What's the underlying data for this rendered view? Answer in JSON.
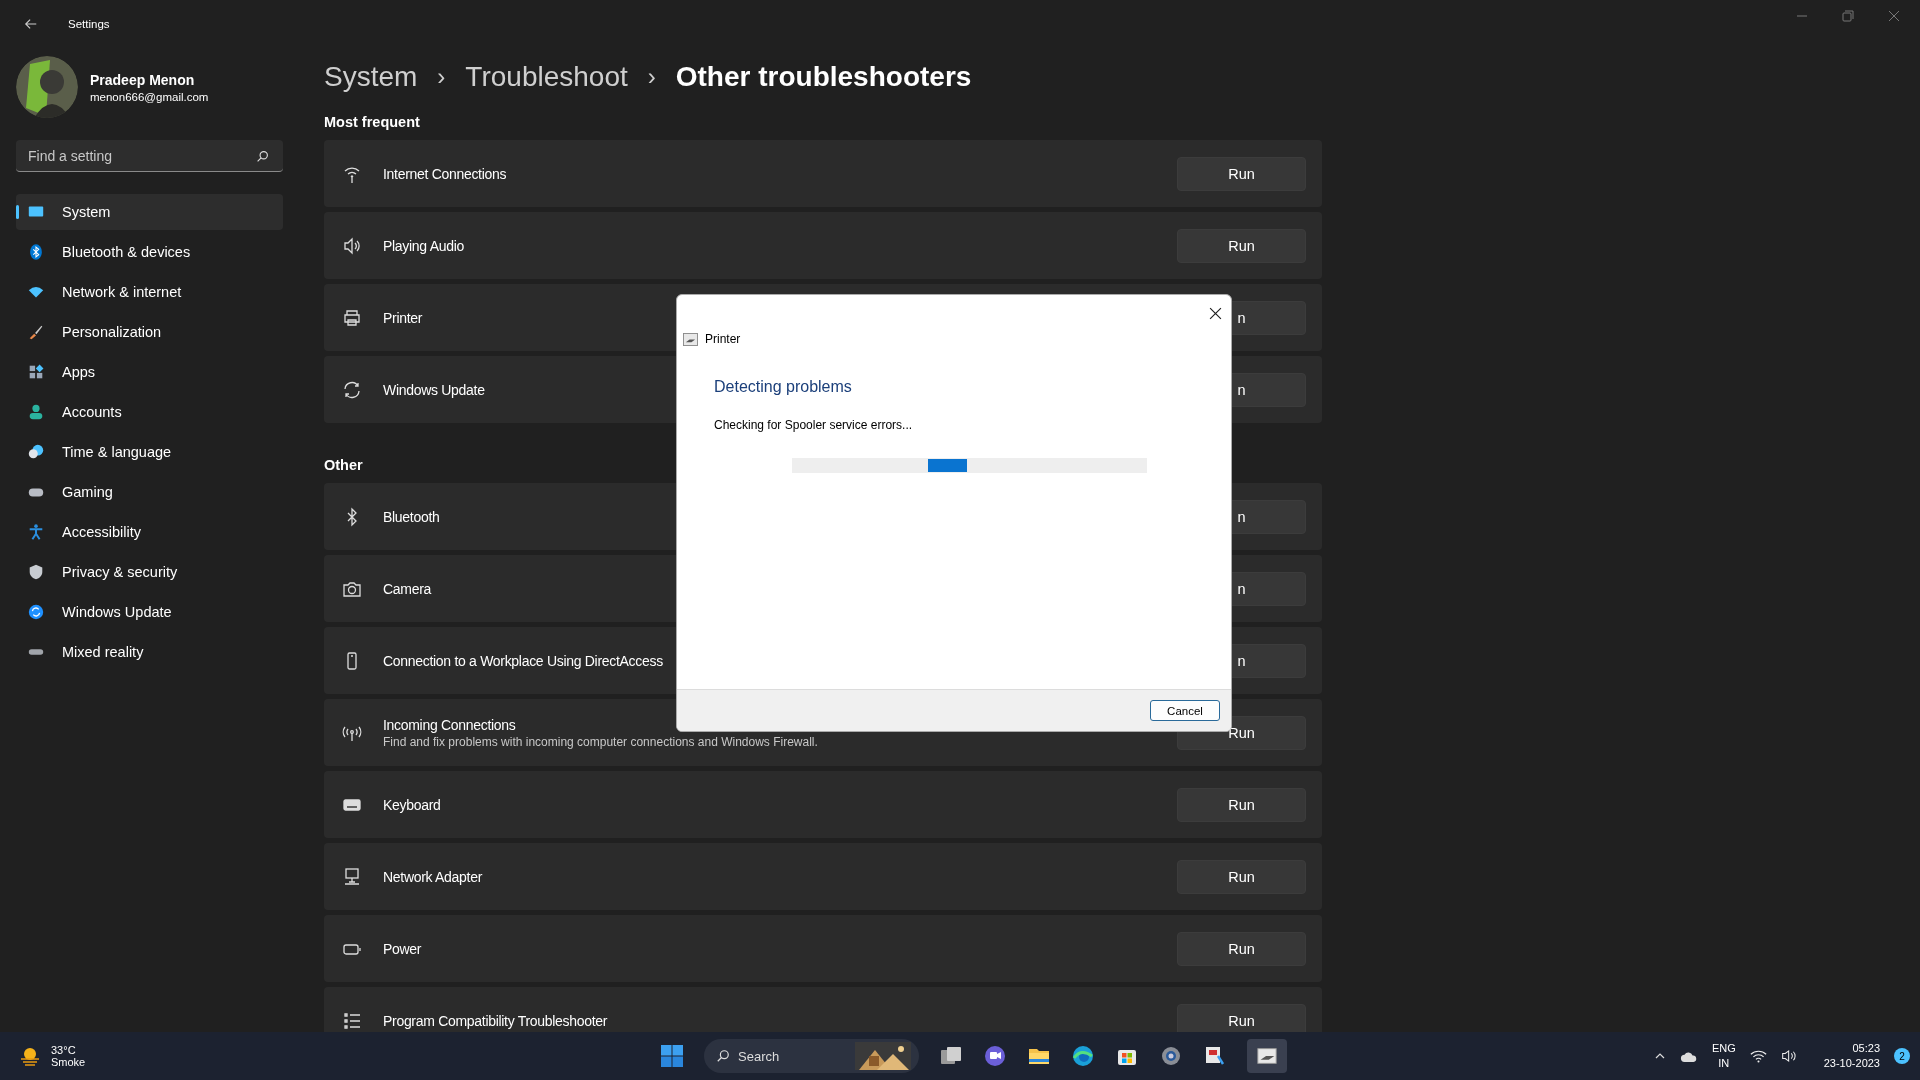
{
  "window": {
    "title": "Settings"
  },
  "profile": {
    "name": "Pradeep Menon",
    "email": "menon666@gmail.com"
  },
  "search": {
    "placeholder": "Find a setting"
  },
  "nav": [
    {
      "label": "System",
      "selected": true
    },
    {
      "label": "Bluetooth & devices",
      "selected": false
    },
    {
      "label": "Network & internet",
      "selected": false
    },
    {
      "label": "Personalization",
      "selected": false
    },
    {
      "label": "Apps",
      "selected": false
    },
    {
      "label": "Accounts",
      "selected": false
    },
    {
      "label": "Time & language",
      "selected": false
    },
    {
      "label": "Gaming",
      "selected": false
    },
    {
      "label": "Accessibility",
      "selected": false
    },
    {
      "label": "Privacy & security",
      "selected": false
    },
    {
      "label": "Windows Update",
      "selected": false
    },
    {
      "label": "Mixed reality",
      "selected": false
    }
  ],
  "breadcrumb": [
    {
      "label": "System"
    },
    {
      "label": "Troubleshoot"
    },
    {
      "label": "Other troubleshooters"
    }
  ],
  "breadcrumb_separator": "›",
  "sections": [
    {
      "title": "Most frequent",
      "items": [
        {
          "title": "Internet Connections",
          "button": "Run"
        },
        {
          "title": "Playing Audio",
          "button": "Run"
        },
        {
          "title": "Printer",
          "button": "n"
        },
        {
          "title": "Windows Update",
          "button": "n"
        }
      ]
    },
    {
      "title": "Other",
      "items": [
        {
          "title": "Bluetooth",
          "button": "n"
        },
        {
          "title": "Camera",
          "button": "n"
        },
        {
          "title": "Connection to a Workplace Using DirectAccess",
          "button": "n"
        },
        {
          "title": "Incoming Connections",
          "description": "Find and fix problems with incoming computer connections and Windows Firewall.",
          "button": "Run"
        },
        {
          "title": "Keyboard",
          "button": "Run"
        },
        {
          "title": "Network Adapter",
          "button": "Run"
        },
        {
          "title": "Power",
          "button": "Run"
        },
        {
          "title": "Program Compatibility Troubleshooter",
          "button": "Run"
        }
      ]
    }
  ],
  "dialog": {
    "title": "Printer",
    "heading": "Detecting problems",
    "message": "Checking for Spooler service errors...",
    "button": "Cancel"
  },
  "taskbar": {
    "weather": {
      "temperature": "33°C",
      "condition": "Smoke"
    },
    "search": {
      "placeholder": "Search"
    },
    "language": {
      "code": "ENG",
      "region": "IN"
    },
    "time": "05:23",
    "date": "23-10-2023",
    "notifications": "2"
  }
}
